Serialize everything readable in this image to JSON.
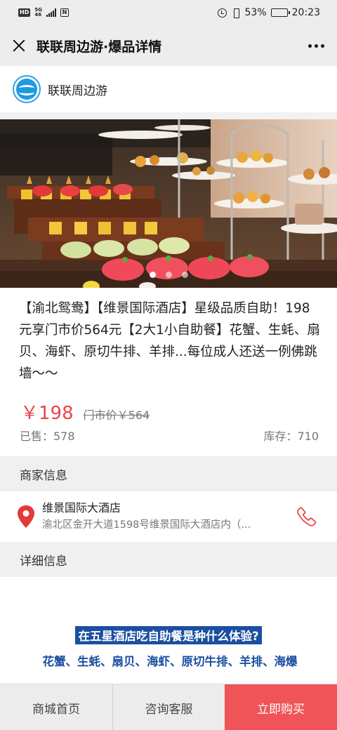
{
  "status_bar": {
    "hd_label": "HD",
    "network_top": "5G",
    "network_bottom": "46",
    "nfc_label": "N",
    "battery_percent": "53%",
    "battery_level": 0.53,
    "time": "20:23"
  },
  "header": {
    "title": "联联周边游·爆品详情",
    "more_icon": "more-dots-icon",
    "close_icon": "close-icon"
  },
  "brand": {
    "name": "联联周边游",
    "logo_color": "#1f9ae0"
  },
  "hero": {
    "image_description_icon": "buffet-photo",
    "dots_count": 3,
    "active_dot": 0
  },
  "product": {
    "title": "【渝北鸳鸯】【维景国际酒店】星级品质自助！198元享门市价564元【2大1小自助餐】花蟹、生蚝、扇贝、海虾、原切牛排、羊排...每位成人还送一例佛跳墙～～",
    "price": "￥198",
    "original_price": "门市价￥564",
    "sold_label": "已售：578",
    "stock_label": "库存：710",
    "price_color": "#e8464a"
  },
  "merchant": {
    "section_title": "商家信息",
    "name": "维景国际大酒店",
    "address": "渝北区金开大道1598号维景国际大酒店内（...",
    "pin_color": "#e23b3b",
    "phone_color": "#e8464a"
  },
  "detail": {
    "section_title": "详细信息",
    "headline": "在五星酒店吃自助餐是种什么体验?",
    "text": "花蟹、生蚝、扇贝、海虾、原切牛排、羊排、海爆",
    "accent_color": "#1b4fa0"
  },
  "bottom_bar": {
    "home_label": "商城首页",
    "service_label": "咨询客服",
    "buy_label": "立即购买",
    "buy_color": "#f05459"
  }
}
